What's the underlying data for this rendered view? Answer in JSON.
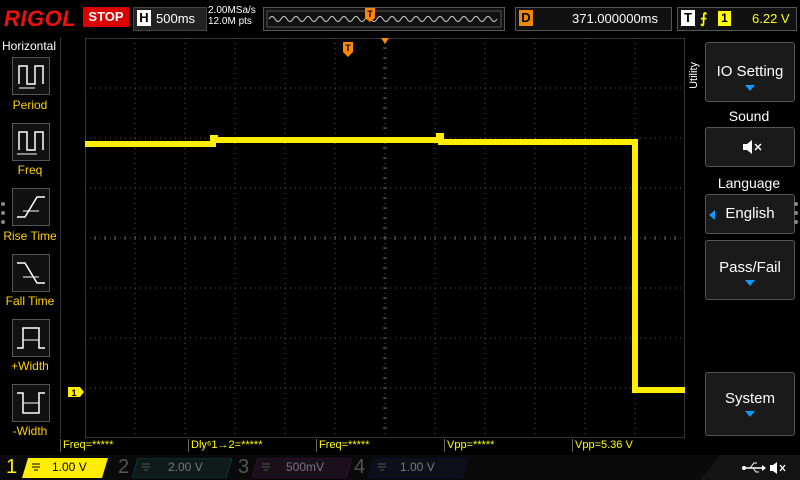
{
  "header": {
    "brand": "RIGOL",
    "run_status": "STOP",
    "timebase_letter": "H",
    "timebase": "500ms",
    "sample_rate": "2.00MSa/s",
    "memory_points": "12.0M pts",
    "delay_letter": "D",
    "delay": "371.000000ms",
    "trigger_letter": "T",
    "trigger_source": "1",
    "trigger_level": "6.22 V"
  },
  "left_panel": {
    "title": "Horizontal",
    "items": [
      {
        "label": "Period",
        "icon": "period-icon"
      },
      {
        "label": "Freq",
        "icon": "freq-icon"
      },
      {
        "label": "Rise Time",
        "icon": "rise-time-icon"
      },
      {
        "label": "Fall Time",
        "icon": "fall-time-icon"
      },
      {
        "label": "+Width",
        "icon": "pos-width-icon"
      },
      {
        "label": "-Width",
        "icon": "neg-width-icon"
      }
    ]
  },
  "right_menu": {
    "vertical_label": "Utility",
    "io_setting": "IO Setting",
    "sound": "Sound",
    "language": "Language",
    "language_value": "English",
    "pass_fail": "Pass/Fail",
    "system": "System"
  },
  "measurements": [
    "Freq=*****",
    "Dly⁶1→2=*****",
    "Freq=*****",
    "Vpp=*****",
    "Vpp=5.36 V"
  ],
  "channels": [
    {
      "num": "1",
      "scale": "1.00 V",
      "color": "#ffee00",
      "active": true
    },
    {
      "num": "2",
      "scale": "2.00 V",
      "color": "#00e0e0",
      "active": false
    },
    {
      "num": "3",
      "scale": "500mV",
      "color": "#d040d0",
      "active": false
    },
    {
      "num": "4",
      "scale": "1.00 V",
      "color": "#3070ff",
      "active": false
    }
  ],
  "marker_labels": {
    "trigger_marker": "T",
    "channel_marker": "1"
  },
  "colors": {
    "ch1": "#ffee00",
    "trigger": "#ff8800",
    "grid": "#555555",
    "accent": "#1a90ff"
  }
}
